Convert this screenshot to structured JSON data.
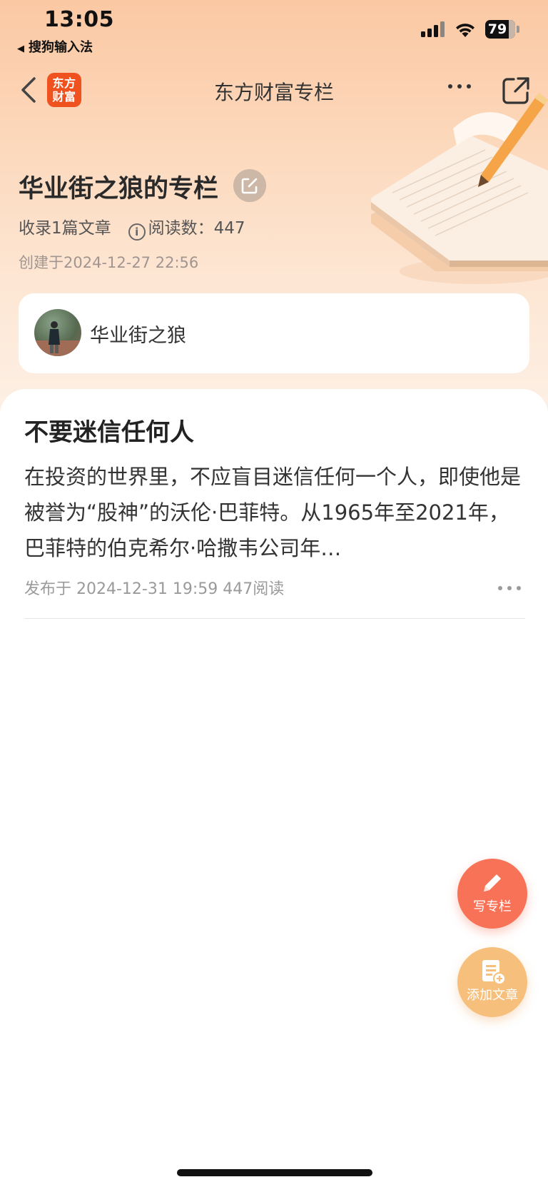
{
  "status_bar": {
    "time": "13:05",
    "back_app": "搜狗输入法",
    "battery": "79"
  },
  "nav": {
    "logo_line1": "东方",
    "logo_line2": "财富",
    "title": "东方财富专栏"
  },
  "column": {
    "title": "华业街之狼的专栏",
    "article_count": "收录1篇文章",
    "read_label": "阅读数：447",
    "created": "创建于2024-12-27 22:56"
  },
  "author": {
    "name": "华业街之狼"
  },
  "articles": [
    {
      "title": "不要迷信任何人",
      "summary": "在投资的世界里，不应盲目迷信任何一个人，即使他是被誉为“股神”的沃伦·巴菲特。从1965年至2021年，巴菲特的伯克希尔·哈撒韦公司年…",
      "meta": "发布于 2024-12-31 19:59 447阅读"
    }
  ],
  "fabs": {
    "write_label": "写专栏",
    "add_label": "添加文章"
  },
  "colors": {
    "brand": "#f0521f",
    "fab_write": "#f87258",
    "fab_add": "#f6bf7c"
  }
}
